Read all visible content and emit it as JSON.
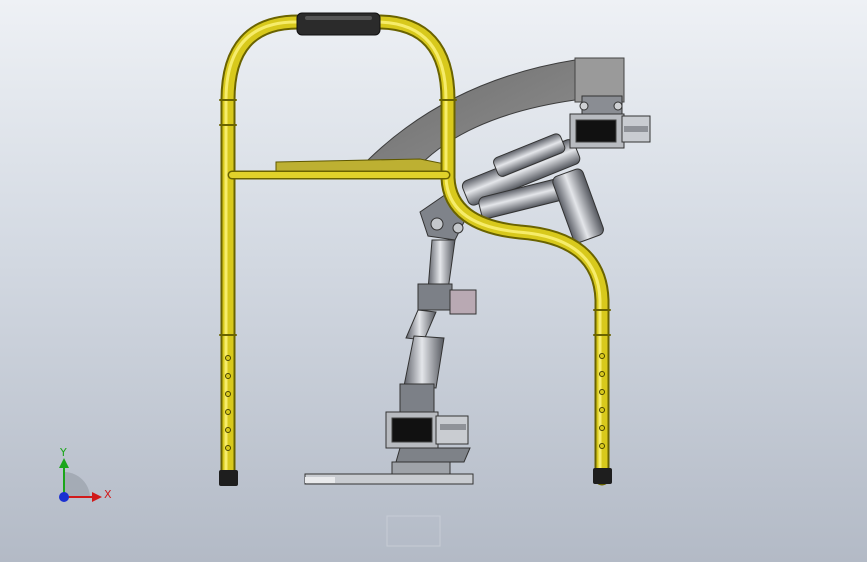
{
  "viewport": {
    "background_top": "#eef1f5",
    "background_bottom": "#b3bac6"
  },
  "model": {
    "frame_color": "#d8c91c",
    "frame_outline": "#6a6300",
    "grip_color": "#2b2b2b",
    "metal_color": "#8a8d93",
    "dark_panel_color": "#1a1a1a",
    "arc_color": "#7c7c7c"
  },
  "triad": {
    "y_label": "Y",
    "x_label": "X",
    "y_color": "#1aa61a",
    "x_color": "#d11a1a",
    "z_color": "#1a2fd1"
  }
}
